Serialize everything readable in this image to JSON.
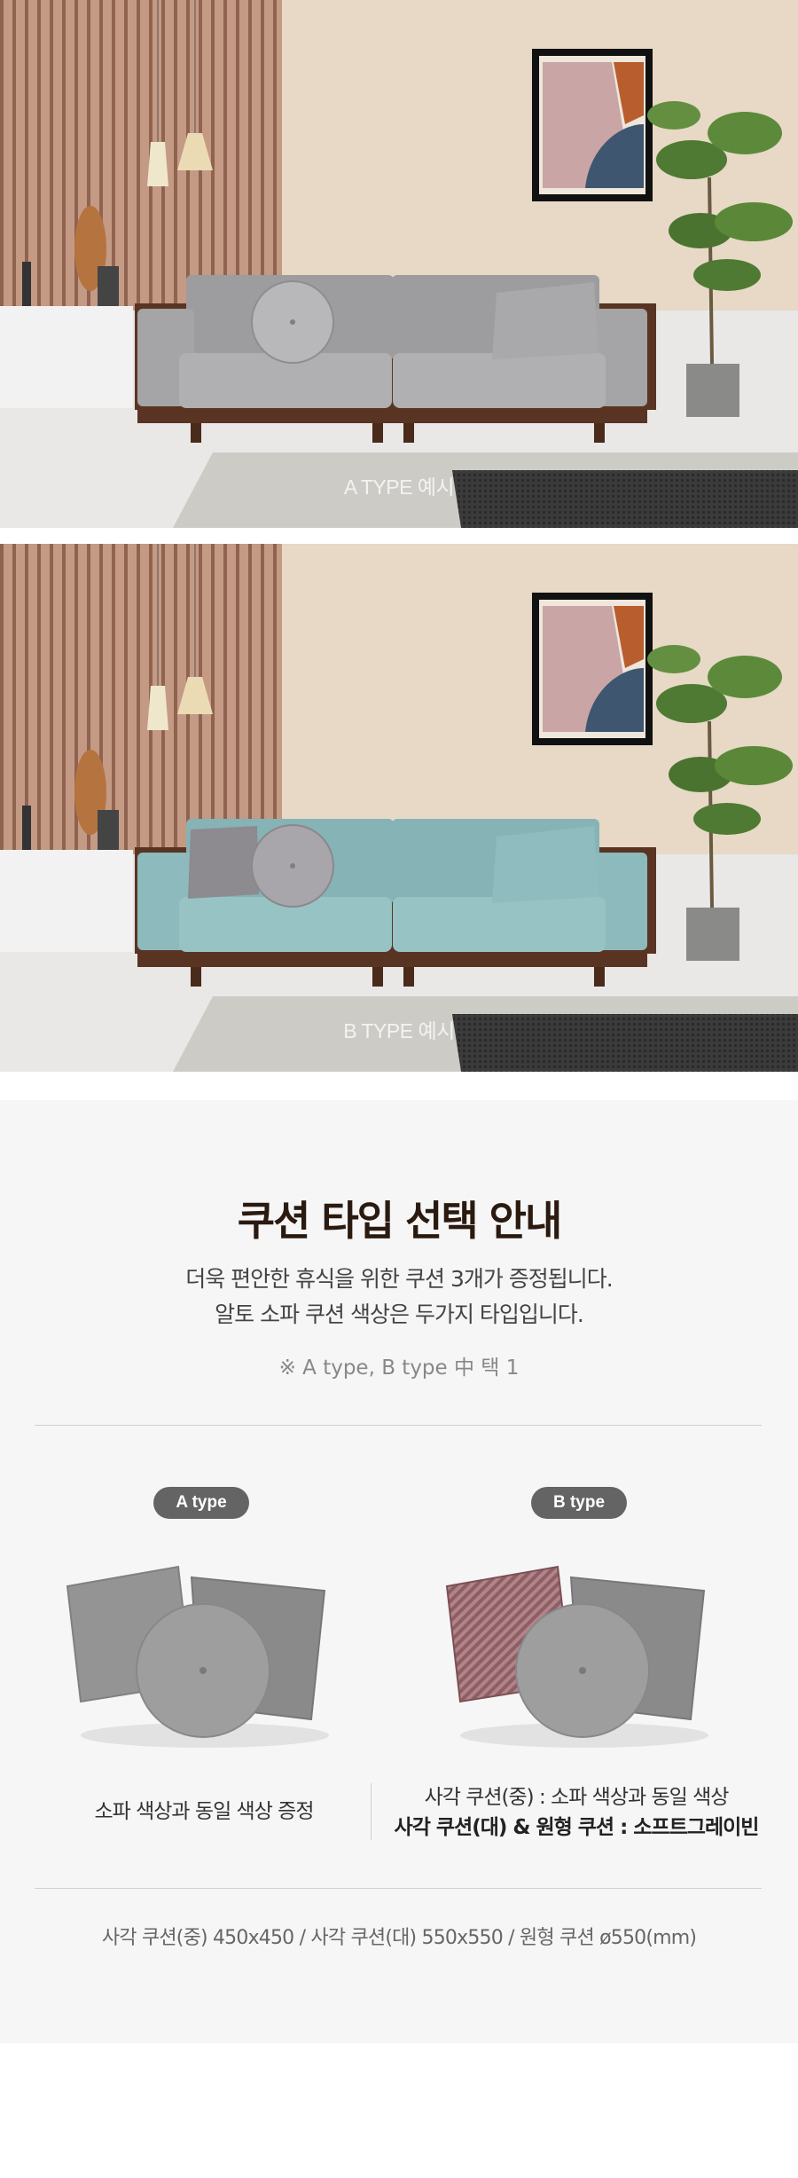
{
  "photo_a": {
    "caption": "A TYPE 예시"
  },
  "photo_b": {
    "caption": "B TYPE 예시"
  },
  "info": {
    "title": "쿠션 타입 선택 안내",
    "desc_line1": "더욱 편안한 휴식을 위한 쿠션 3개가 증정됩니다.",
    "desc_line2": "알토 소파 쿠션 색상은 두가지 타입입니다.",
    "note": "※ A type, B type 中 택 1",
    "type_a": {
      "badge": "A type",
      "caption": "소파 색상과 동일 색상 증정"
    },
    "type_b": {
      "badge": "B type",
      "caption_line1": "사각 쿠션(중) : 소파 색상과 동일 색상",
      "caption_line2": "사각 쿠션(대) & 원형 쿠션 : 소프트그레이빈"
    },
    "sizes": "사각 쿠션(중) 450x450 / 사각 쿠션(대) 550x550 / 원형 쿠션 ø550(mm)"
  },
  "colors": {
    "sofa_a": "#9b9a9c",
    "sofa_b": "#86b3b5",
    "wood": "#5a3422",
    "background_panel": "#f6f6f6",
    "badge": "#646464",
    "title": "#2a1a10"
  }
}
